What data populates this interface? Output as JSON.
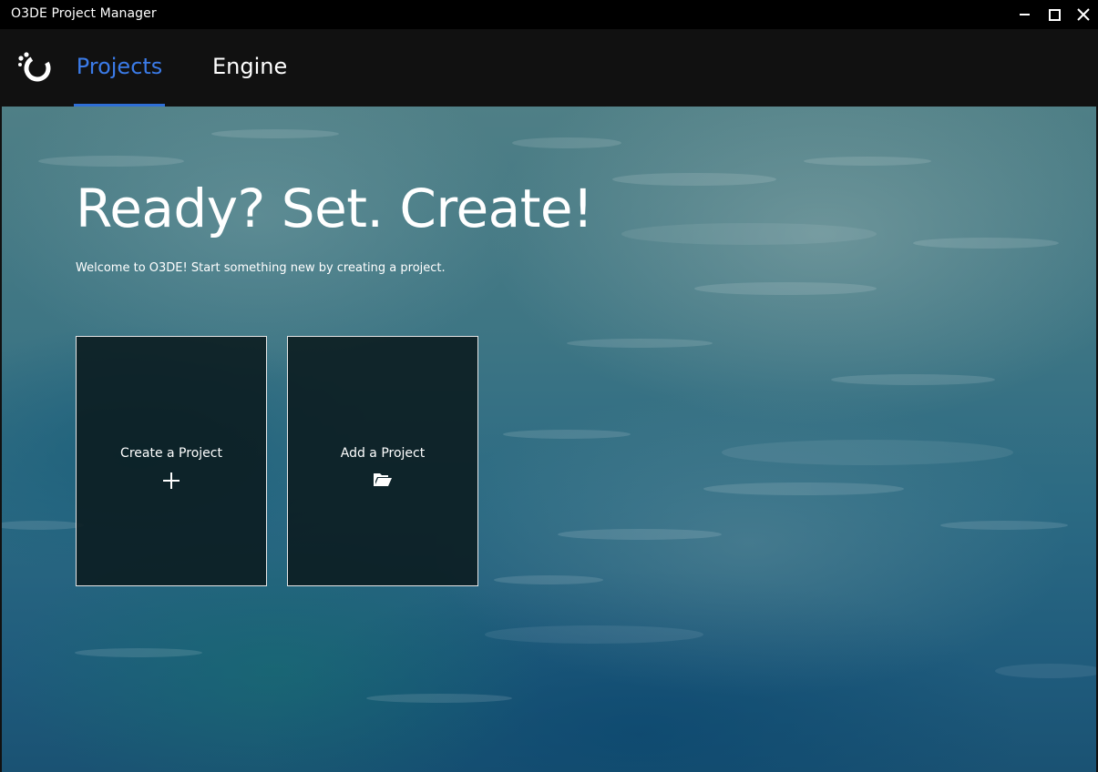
{
  "window": {
    "title": "O3DE Project Manager"
  },
  "nav": {
    "tabs": [
      {
        "label": "Projects",
        "active": true
      },
      {
        "label": "Engine",
        "active": false
      }
    ],
    "active_color": "#3b7be8"
  },
  "hero": {
    "headline": "Ready? Set. Create!",
    "subtext": "Welcome to O3DE! Start something new by creating a project."
  },
  "cards": [
    {
      "label": "Create a Project",
      "icon": "plus-icon"
    },
    {
      "label": "Add a Project",
      "icon": "folder-open-icon"
    }
  ]
}
